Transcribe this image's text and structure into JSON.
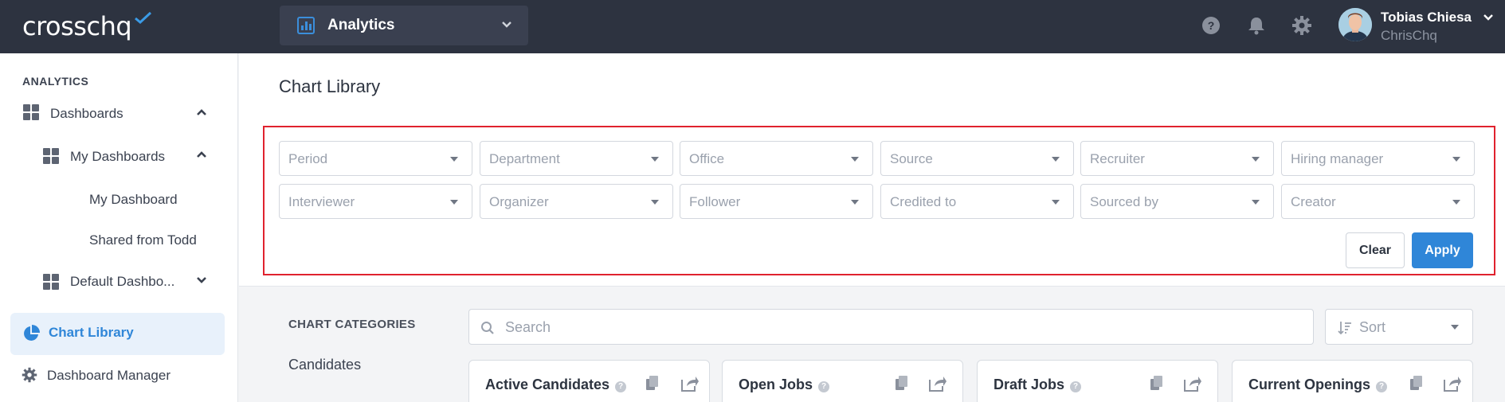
{
  "topbar": {
    "logo_text": "crosschq",
    "module": "Analytics",
    "user_name": "Tobias Chiesa",
    "user_org": "ChrisChq",
    "icons": [
      "help-icon",
      "bell-icon",
      "gear-icon"
    ]
  },
  "sidebar": {
    "section_heading": "ANALYTICS",
    "items": {
      "dashboards": "Dashboards",
      "my_dashboards": "My Dashboards",
      "my_dashboard": "My Dashboard",
      "shared": "Shared from Todd",
      "default": "Default Dashbo...",
      "chart_library": "Chart Library",
      "dashboard_manager": "Dashboard Manager"
    }
  },
  "main": {
    "title": "Chart Library",
    "filters_row1": [
      "Period",
      "Department",
      "Office",
      "Source",
      "Recruiter",
      "Hiring manager"
    ],
    "filters_row2": [
      "Interviewer",
      "Organizer",
      "Follower",
      "Credited to",
      "Sourced by",
      "Creator"
    ],
    "clear_label": "Clear",
    "apply_label": "Apply",
    "categories_heading": "CHART CATEGORIES",
    "categories": [
      "Candidates"
    ],
    "search_placeholder": "Search",
    "sort_placeholder": "Sort",
    "cards": [
      "Active Candidates",
      "Open Jobs",
      "Draft Jobs",
      "Current Openings"
    ]
  },
  "colors": {
    "topbar": "#2d3340",
    "accent": "#2f86d8",
    "highlight_frame": "#e0222e"
  }
}
